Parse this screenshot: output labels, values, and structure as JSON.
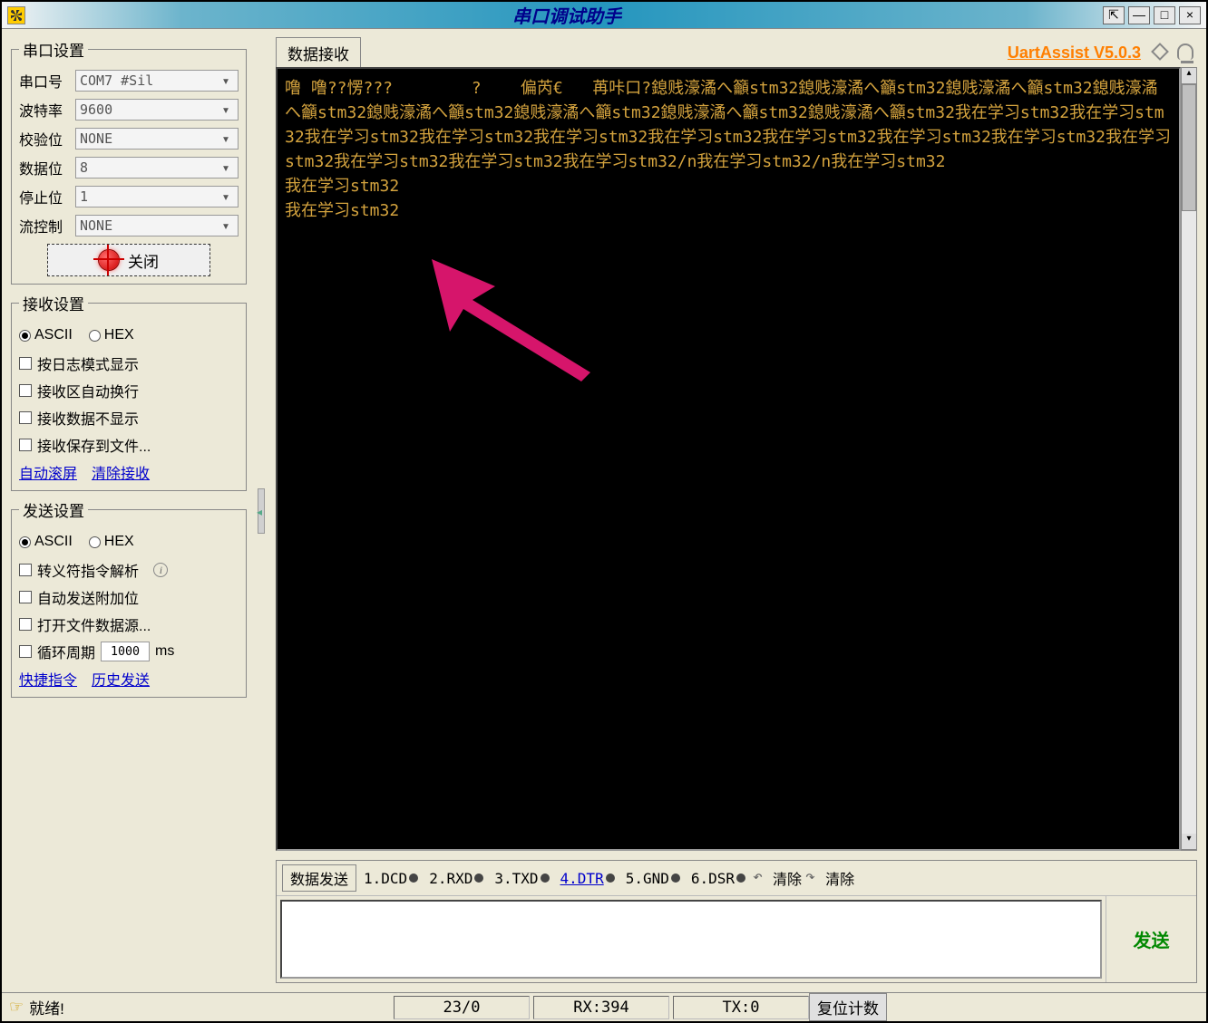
{
  "title": "串口调试助手",
  "version_label": "UartAssist V5.0.3",
  "serial_settings": {
    "legend": "串口设置",
    "port_label": "串口号",
    "port_value": "COM7 #Sil",
    "baud_label": "波特率",
    "baud_value": "9600",
    "parity_label": "校验位",
    "parity_value": "NONE",
    "databits_label": "数据位",
    "databits_value": "8",
    "stopbits_label": "停止位",
    "stopbits_value": "1",
    "flow_label": "流控制",
    "flow_value": "NONE",
    "close_btn": "关闭"
  },
  "recv_settings": {
    "legend": "接收设置",
    "ascii": "ASCII",
    "hex": "HEX",
    "log_mode": "按日志模式显示",
    "auto_wrap": "接收区自动换行",
    "hide_recv": "接收数据不显示",
    "save_file": "接收保存到文件...",
    "auto_scroll": "自动滚屏",
    "clear_recv": "清除接收"
  },
  "send_settings": {
    "legend": "发送设置",
    "ascii": "ASCII",
    "hex": "HEX",
    "escape": "转义符指令解析",
    "auto_append": "自动发送附加位",
    "open_file": "打开文件数据源...",
    "cycle": "循环周期",
    "cycle_value": "1000",
    "cycle_unit": "ms",
    "quick_cmd": "快捷指令",
    "history": "历史发送"
  },
  "rx_tab": "数据接收",
  "console_text": "噜 噜??愣???        ?    偏芮€   苒咔口?鎴贱濠潏へ籲stm32鎴贱濠潏へ籲stm32鎴贱濠潏へ籲stm32鎴贱濠潏へ籲stm32鎴贱濠潏へ籲stm32鎴贱濠潏へ籲stm32鎴贱濠潏へ籲stm32鎴贱濠潏へ籲stm32我在学习stm32我在学习stm32我在学习stm32我在学习stm32我在学习stm32我在学习stm32我在学习stm32我在学习stm32我在学习stm32我在学习stm32我在学习stm32我在学习stm32我在学习stm32/n我在学习stm32/n我在学习stm32\n我在学习stm32\n我在学习stm32",
  "tx_tab": "数据发送",
  "pins": {
    "p1": "1.DCD",
    "p2": "2.RXD",
    "p3": "3.TXD",
    "p4": "4.DTR",
    "p5": "5.GND",
    "p6": "6.DSR"
  },
  "clear_left": "清除",
  "clear_right": "清除",
  "send_btn": "发送",
  "status": {
    "ready": "就绪!",
    "count": "23/0",
    "rx": "RX:394",
    "tx": "TX:0",
    "reset": "复位计数"
  }
}
